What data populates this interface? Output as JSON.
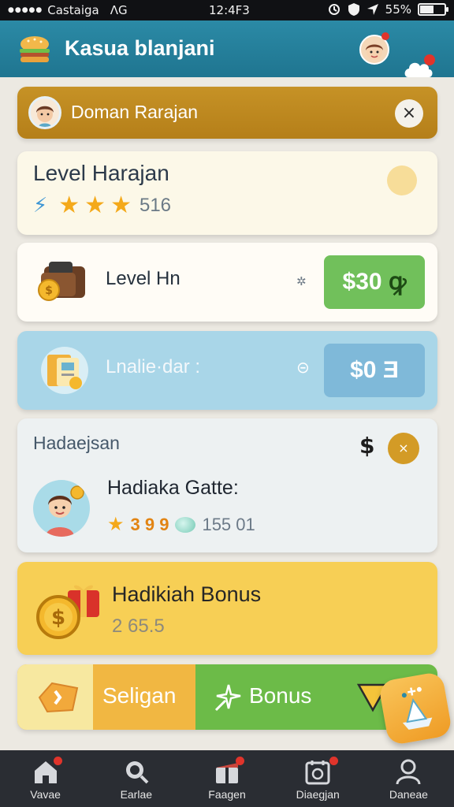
{
  "status_bar": {
    "carrier": "Castaiga",
    "network": "ΛG",
    "time": "12:4F3",
    "battery": "55%",
    "battery_level": 0.55
  },
  "header": {
    "title": "Kasua blanjani"
  },
  "banner": {
    "text": "Doman Rarajan",
    "close": "×"
  },
  "level": {
    "title": "Level  Harajan",
    "stars": 3,
    "rating": "516"
  },
  "offers": [
    {
      "label": "Level Hn",
      "marker": "✲",
      "price": "$30",
      "price_glyph": "ꝙ"
    },
    {
      "label": "Lnalie·dar :",
      "marker": "⊝",
      "price": "$0",
      "price_glyph": "Ǝ"
    }
  ],
  "reward": {
    "heading": "Hadaejsan",
    "currency": "$",
    "circle_glyph": "×",
    "title": "Hadiaka Gatte:",
    "score": "3 9 9",
    "gems": "155 01"
  },
  "bonus": {
    "title": "Hadikiah Bonus",
    "value": "2  65.5"
  },
  "actions": {
    "left_label": "Seligan",
    "right_label": "Bonus"
  },
  "nav": [
    {
      "label": "Vavae",
      "icon": "home-icon",
      "badge": true
    },
    {
      "label": "Earlae",
      "icon": "search-icon",
      "badge": false
    },
    {
      "label": "Faagen",
      "icon": "gift-icon",
      "badge": true
    },
    {
      "label": "Diaegjan",
      "icon": "calendar-icon",
      "badge": true
    },
    {
      "label": "Daneae",
      "icon": "profile-icon",
      "badge": false
    }
  ],
  "colors": {
    "header": "#2b8aa6",
    "banner": "#c69226",
    "green": "#71c05b",
    "blue": "#a9d6e8",
    "yellow": "#f7cf55",
    "nav": "#2a2d33"
  }
}
